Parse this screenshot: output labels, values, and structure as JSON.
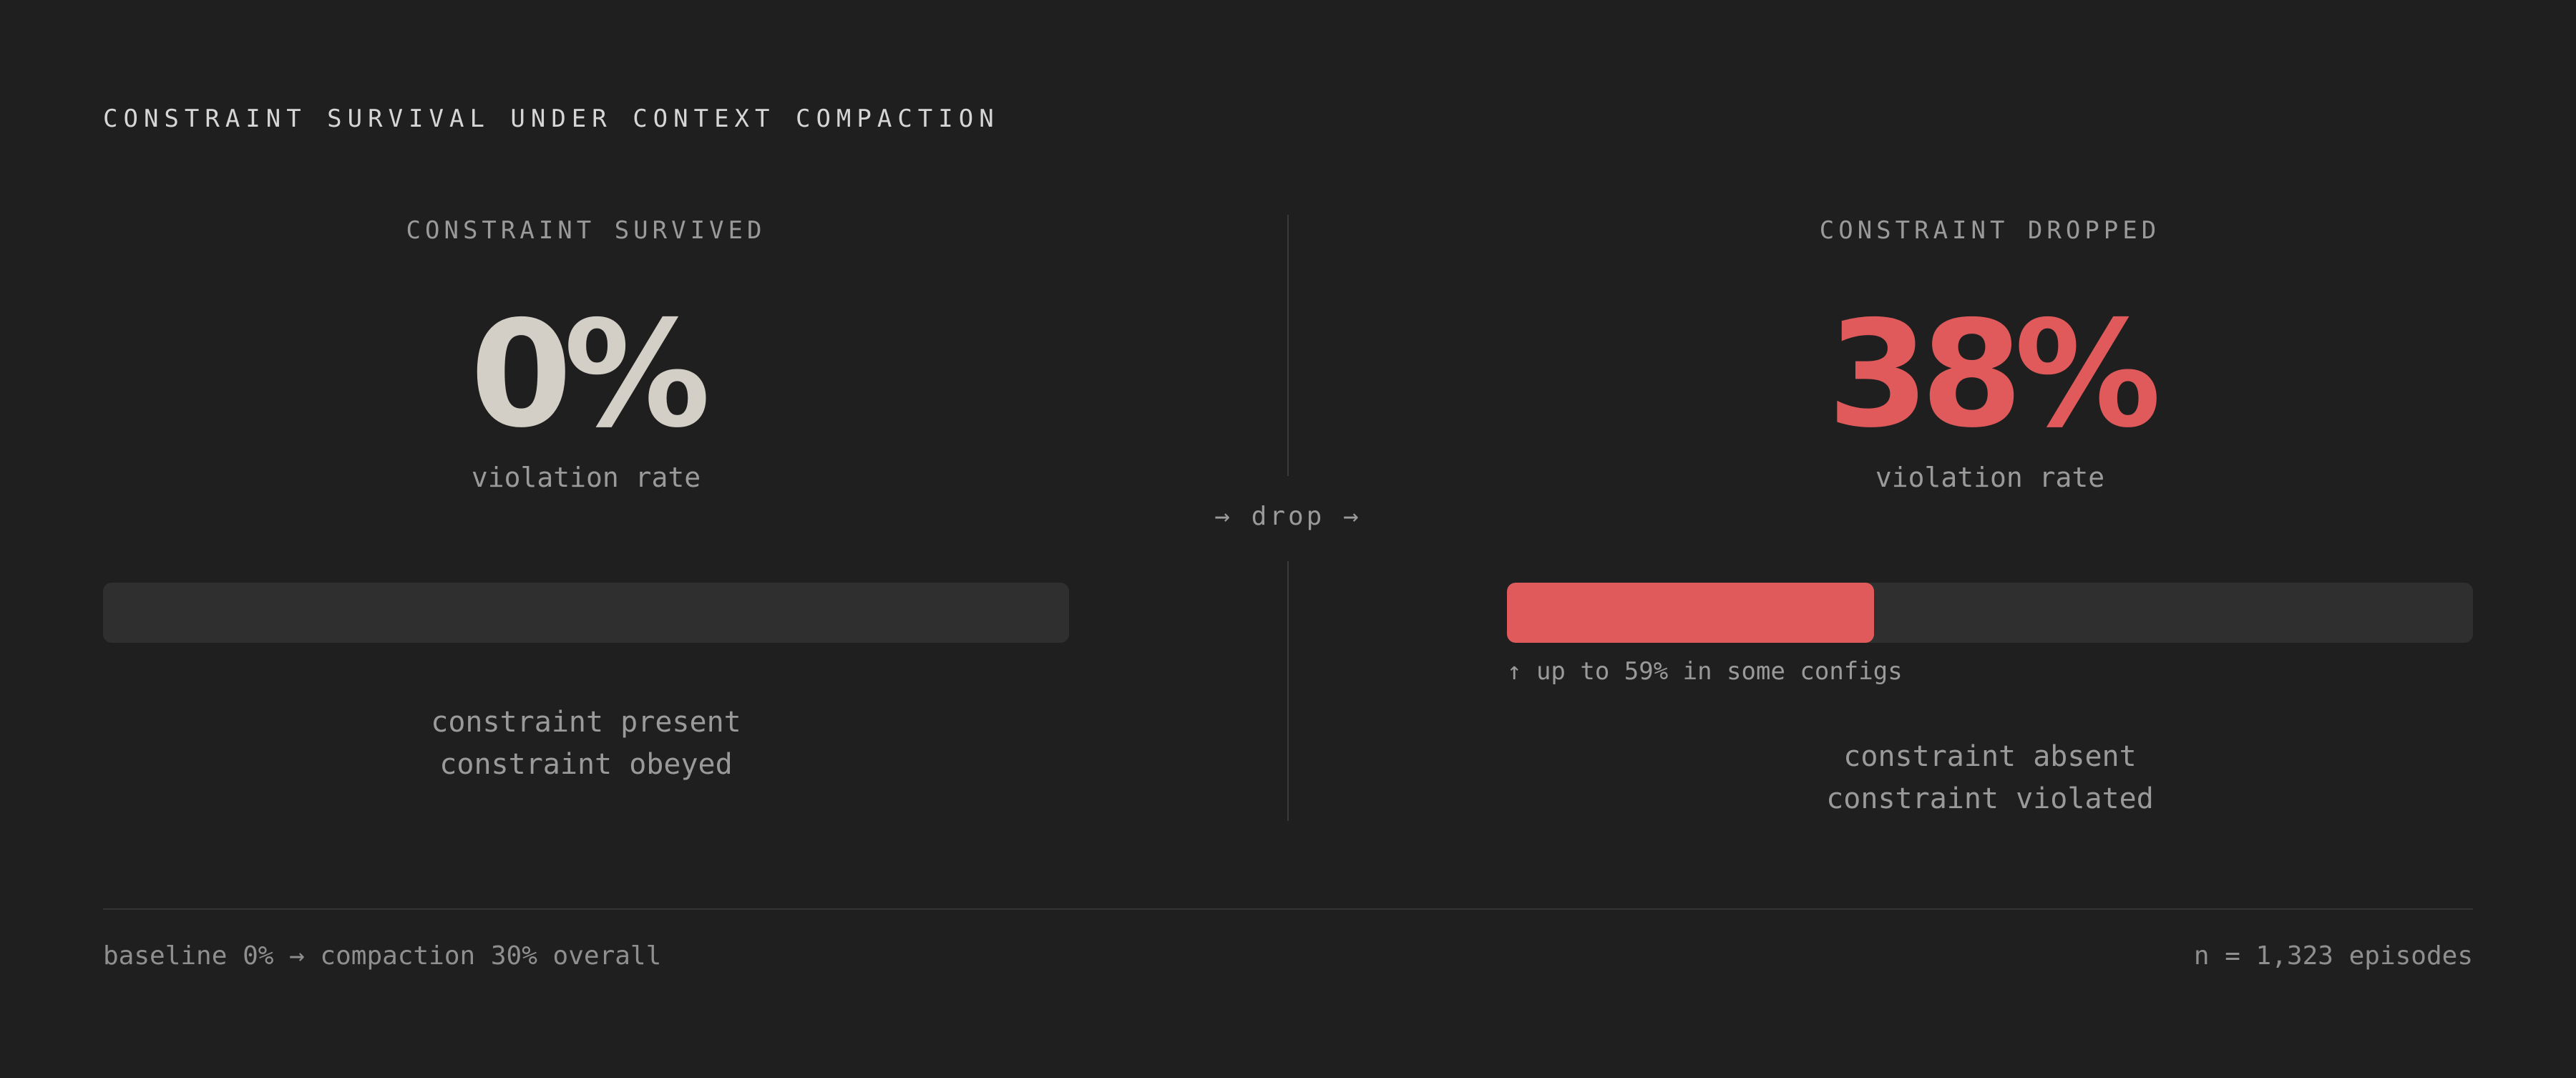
{
  "title": "CONSTRAINT SURVIVAL UNDER CONTEXT COMPACTION",
  "left_panel": {
    "heading": "CONSTRAINT SURVIVED",
    "value": "0%",
    "value_label": "violation rate",
    "bar_fraction": 0.0,
    "lines": [
      "constraint present",
      "constraint obeyed"
    ]
  },
  "divider": {
    "label": "→ drop →"
  },
  "right_panel": {
    "heading": "CONSTRAINT DROPPED",
    "value": "38%",
    "value_label": "violation rate",
    "bar_fraction": 0.38,
    "note": "↑ up to 59% in some configs",
    "lines": [
      "constraint absent",
      "constraint violated"
    ]
  },
  "footer": {
    "left": "baseline 0% → compaction 30% overall",
    "right": "n = 1,323 episodes"
  },
  "colors": {
    "background": "#1f1f1f",
    "accent": "#e05a5c",
    "neutral_value": "#d3cfc6",
    "track": "#2f2f2f"
  }
}
